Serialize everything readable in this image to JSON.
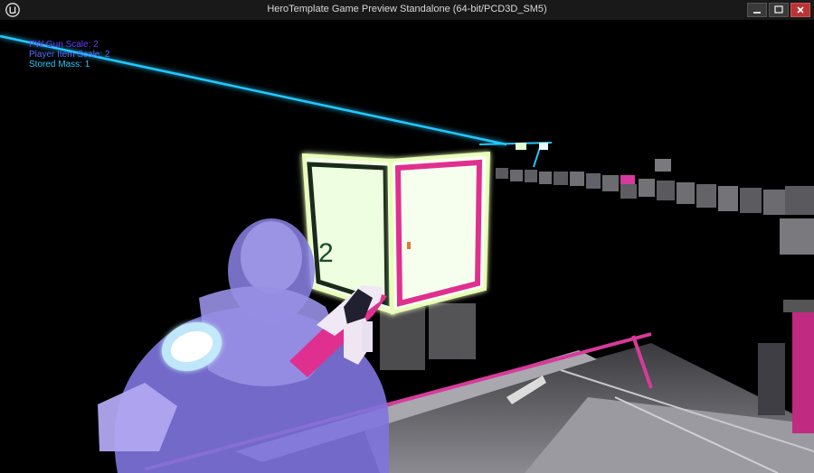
{
  "window": {
    "title": "HeroTemplate Game Preview Standalone (64-bit/PCD3D_SM5)",
    "app_icon": "unreal-engine-logo"
  },
  "hud": {
    "lines": [
      "PW Gun Scale: 2",
      "Player Item Scale: 2",
      "Stored Mass: 1"
    ]
  },
  "scene": {
    "cube_number": "2",
    "colors": {
      "laser": "#22c8ff",
      "cube_glow": "#e9ffb8",
      "magenta": "#e0308f",
      "character": "#8c82e6",
      "shoulder_glow": "#c8f4ff"
    }
  }
}
